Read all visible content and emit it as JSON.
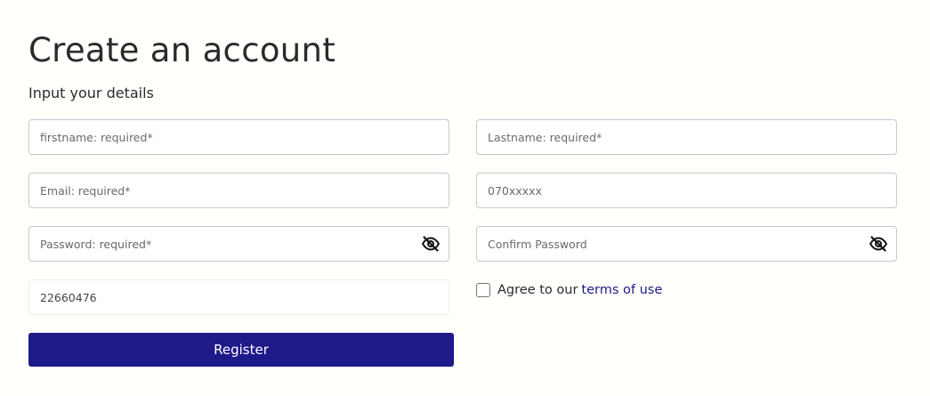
{
  "form": {
    "title": "Create an account",
    "subtitle": "Input your details",
    "fields": {
      "firstname": {
        "placeholder": "firstname: required*",
        "value": ""
      },
      "lastname": {
        "placeholder": "Lastname: required*",
        "value": ""
      },
      "email": {
        "placeholder": "Email: required*",
        "value": ""
      },
      "phone": {
        "placeholder": "070xxxxx",
        "value": ""
      },
      "password": {
        "placeholder": "Password: required*",
        "value": ""
      },
      "confirm_password": {
        "placeholder": "Confirm Password",
        "value": ""
      },
      "code": {
        "placeholder": "",
        "value": "22660476"
      }
    },
    "password_toggle_icon": "eye-slash-icon",
    "agree": {
      "text": "Agree to our",
      "link_text": "terms of use",
      "checked": false
    },
    "register_label": "Register"
  },
  "colors": {
    "primary": "#1e1a8a",
    "background": "#fffffb",
    "field_border": "#c8c8cc",
    "text": "#2b2b2b"
  }
}
